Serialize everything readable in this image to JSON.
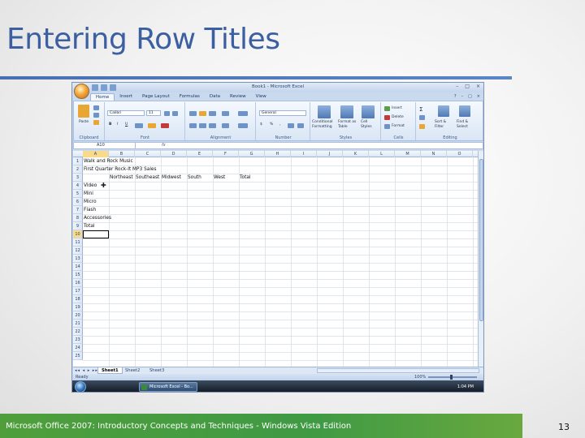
{
  "slide": {
    "title": "Entering Row Titles",
    "footer": "Microsoft Office 2007: Introductory Concepts and Techniques - Windows Vista Edition",
    "page_number": "13"
  },
  "excel": {
    "window_title": "Book1 - Microsoft Excel",
    "tabs": [
      "Home",
      "Insert",
      "Page Layout",
      "Formulas",
      "Data",
      "Review",
      "View"
    ],
    "active_tab": "Home",
    "ribbon": {
      "clipboard": {
        "label": "Clipboard",
        "paste": "Paste"
      },
      "font": {
        "label": "Font",
        "name": "Calibri",
        "size": "11"
      },
      "alignment": {
        "label": "Alignment"
      },
      "number": {
        "label": "Number",
        "format": "General"
      },
      "styles": {
        "label": "Styles",
        "conditional": "Conditional Formatting",
        "format_table": "Format as Table",
        "cell_styles": "Cell Styles"
      },
      "cells": {
        "label": "Cells",
        "insert": "Insert",
        "delete": "Delete",
        "format": "Format"
      },
      "editing": {
        "label": "Editing",
        "sort": "Sort & Filter",
        "find": "Find & Select"
      }
    },
    "name_box": "A10",
    "fx": "fx",
    "columns": [
      "A",
      "B",
      "C",
      "D",
      "E",
      "F",
      "G",
      "H",
      "I",
      "J",
      "K",
      "L",
      "M",
      "N",
      "O"
    ],
    "rows": [
      "1",
      "2",
      "3",
      "4",
      "5",
      "6",
      "7",
      "8",
      "9",
      "10",
      "11",
      "12",
      "13",
      "14",
      "15",
      "16",
      "17",
      "18",
      "19",
      "20",
      "21",
      "22",
      "23",
      "24",
      "25"
    ],
    "cells": {
      "A1": "Walk and Rock Music",
      "A2": "First Quarter Rock-It MP3 Sales",
      "B3": "Northeast",
      "C3": "Southeast",
      "D3": "Midwest",
      "E3": "South",
      "F3": "West",
      "G3": "Total",
      "A4": "Video",
      "A5": "Mini",
      "A6": "Micro",
      "A7": "Flash",
      "A8": "Accessories",
      "A9": "Total"
    },
    "sheets": [
      "Sheet1",
      "Sheet2",
      "Sheet3"
    ],
    "active_sheet": "Sheet1",
    "status": "Ready",
    "zoom": "100%",
    "taskbar_item": "Microsoft Excel - Bo...",
    "clock": "1:04 PM"
  }
}
